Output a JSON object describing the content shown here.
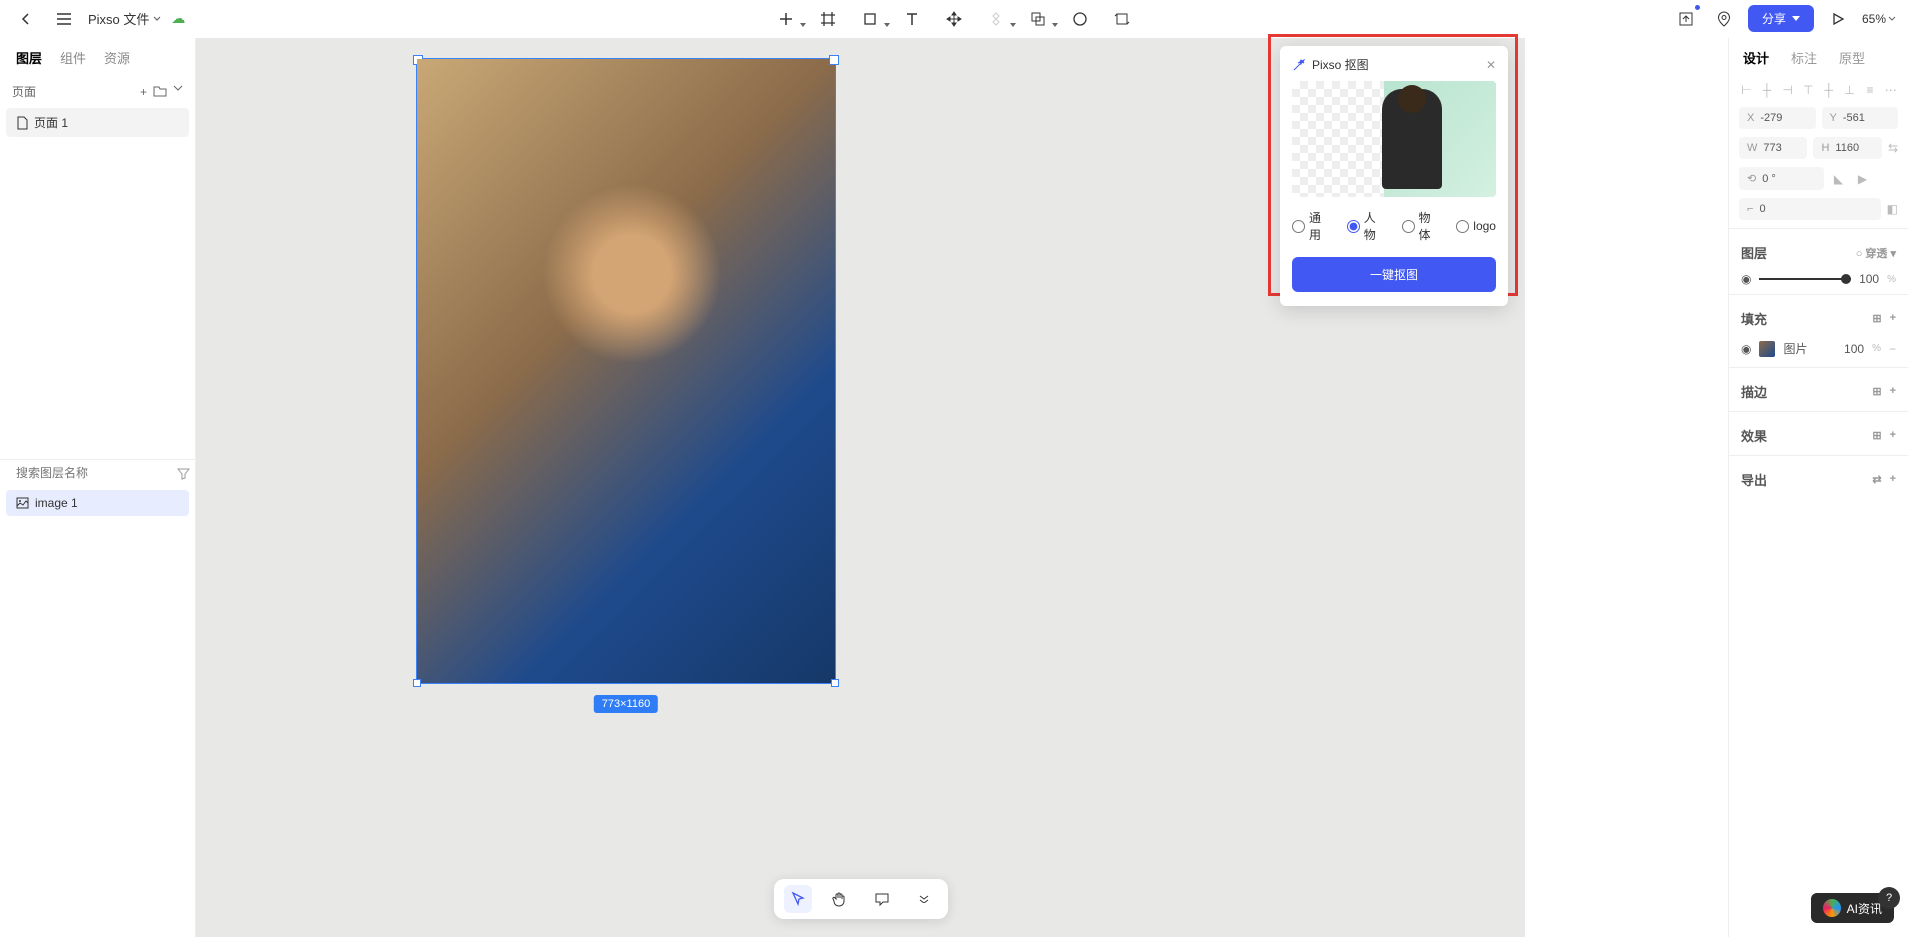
{
  "header": {
    "file_title": "Pixso 文件",
    "share_label": "分享",
    "zoom": "65%"
  },
  "left": {
    "tabs": [
      "图层",
      "组件",
      "资源"
    ],
    "pages_label": "页面",
    "pages": [
      "页面 1"
    ],
    "search_placeholder": "搜索图层名称",
    "layers": [
      "image 1"
    ]
  },
  "canvas": {
    "size_label": "773×1160"
  },
  "cutout": {
    "title": "Pixso 抠图",
    "options": [
      "通用",
      "人物",
      "物体",
      "logo"
    ],
    "selected": 1,
    "button": "一键抠图"
  },
  "right": {
    "tabs": [
      "设计",
      "标注",
      "原型"
    ],
    "x": "-279",
    "y": "-561",
    "w": "773",
    "h": "1160",
    "rotation": "0 °",
    "radius": "0",
    "layer_section": "图层",
    "layer_mode": "穿透",
    "opacity": "100",
    "fill_section": "填充",
    "fill_label": "图片",
    "fill_opacity": "100",
    "stroke_section": "描边",
    "effect_section": "效果",
    "export_section": "导出"
  },
  "floatbar": {},
  "watermark": "AI资讯"
}
